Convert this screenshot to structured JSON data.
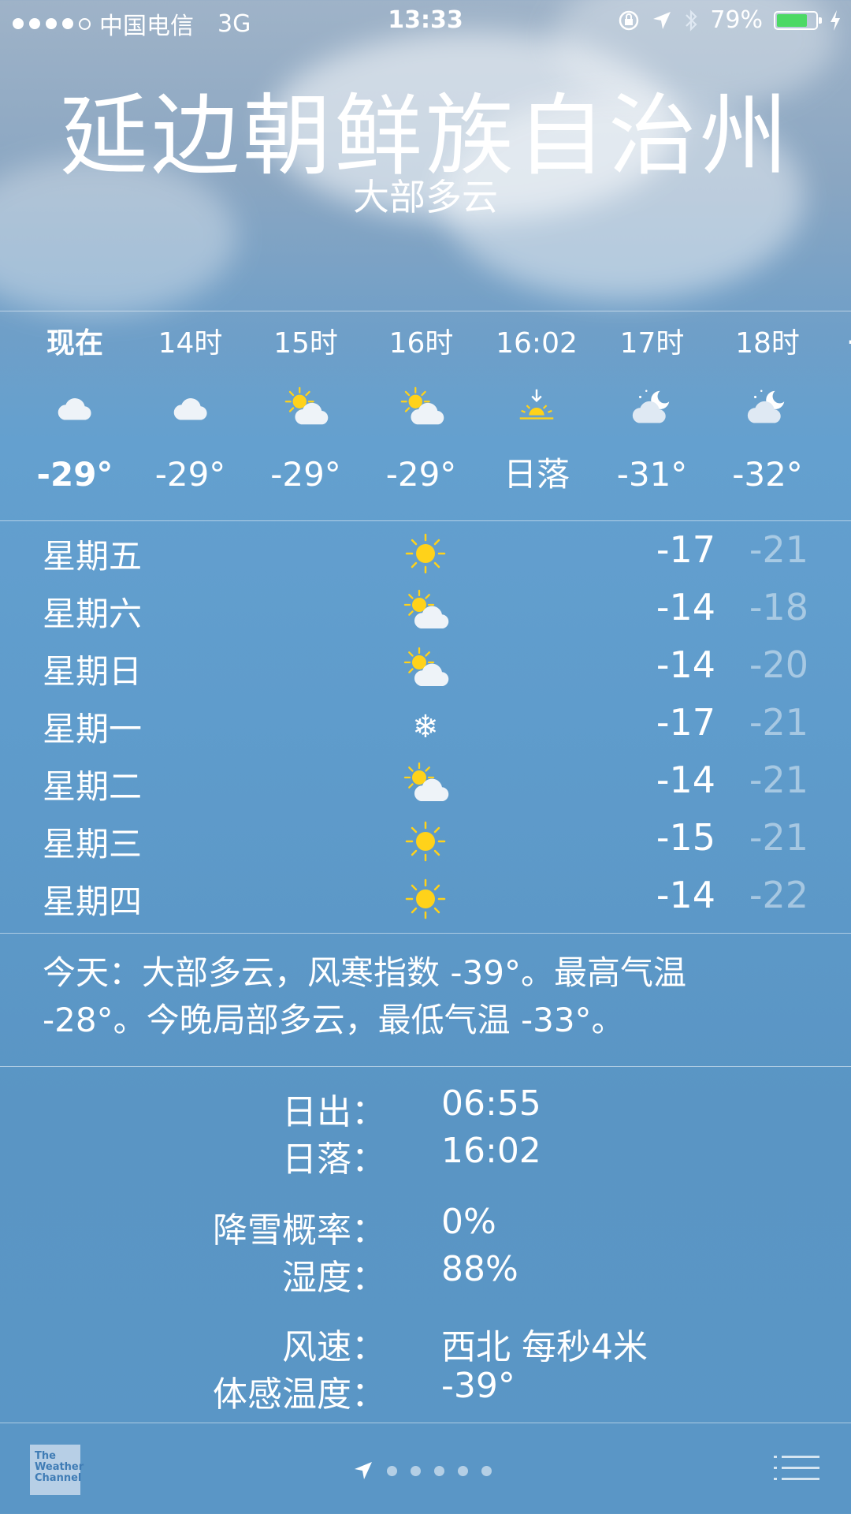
{
  "status_bar": {
    "carrier": "中国电信",
    "network": "3G",
    "time": "13:33",
    "battery": "79%",
    "battery_level": 0.79
  },
  "location": {
    "city": "延边朝鲜族自治州",
    "condition": "大部多云"
  },
  "hourly": [
    {
      "time": "现在",
      "icon": "cloud-icon",
      "value": "-29°"
    },
    {
      "time": "14时",
      "icon": "cloud-icon",
      "value": "-29°"
    },
    {
      "time": "15时",
      "icon": "partly-sunny-icon",
      "value": "-29°"
    },
    {
      "time": "16时",
      "icon": "partly-sunny-icon",
      "value": "-29°"
    },
    {
      "time": "16:02",
      "icon": "sunset-icon",
      "value": "日落"
    },
    {
      "time": "17时",
      "icon": "partly-cloudy-night-icon",
      "value": "-31°"
    },
    {
      "time": "18时",
      "icon": "partly-cloudy-night-icon",
      "value": "-32°"
    }
  ],
  "daily": [
    {
      "day": "星期五",
      "icon": "sun-icon",
      "high": "-17",
      "low": "-21"
    },
    {
      "day": "星期六",
      "icon": "partly-sunny-icon",
      "high": "-14",
      "low": "-18"
    },
    {
      "day": "星期日",
      "icon": "partly-sunny-icon",
      "high": "-14",
      "low": "-20"
    },
    {
      "day": "星期一",
      "icon": "snowflake-icon",
      "high": "-17",
      "low": "-21"
    },
    {
      "day": "星期二",
      "icon": "partly-sunny-icon",
      "high": "-14",
      "low": "-21"
    },
    {
      "day": "星期三",
      "icon": "sun-icon",
      "high": "-15",
      "low": "-21"
    },
    {
      "day": "星期四",
      "icon": "sun-icon",
      "high": "-14",
      "low": "-22"
    }
  ],
  "summary": {
    "line1": "今天：大部多云，风寒指数 -39°。最高气温",
    "line2": "-28°。今晚局部多云，最低气温 -33°。"
  },
  "details": {
    "sunrise_label": "日出：",
    "sunrise": "06:55",
    "sunset_label": "日落：",
    "sunset": "16:02",
    "snow_label": "降雪概率：",
    "snow": "0%",
    "humidity_label": "湿度：",
    "humidity": "88%",
    "wind_label": "风速：",
    "wind": "西北 每秒4米",
    "feels_label": "体感温度：",
    "feels": "-39°"
  },
  "footer": {
    "logo_line1": "The",
    "logo_line2": "Weather",
    "logo_line3": "Channel"
  },
  "colors": {
    "sun": "#ffd21a",
    "battery": "#4cd964"
  }
}
